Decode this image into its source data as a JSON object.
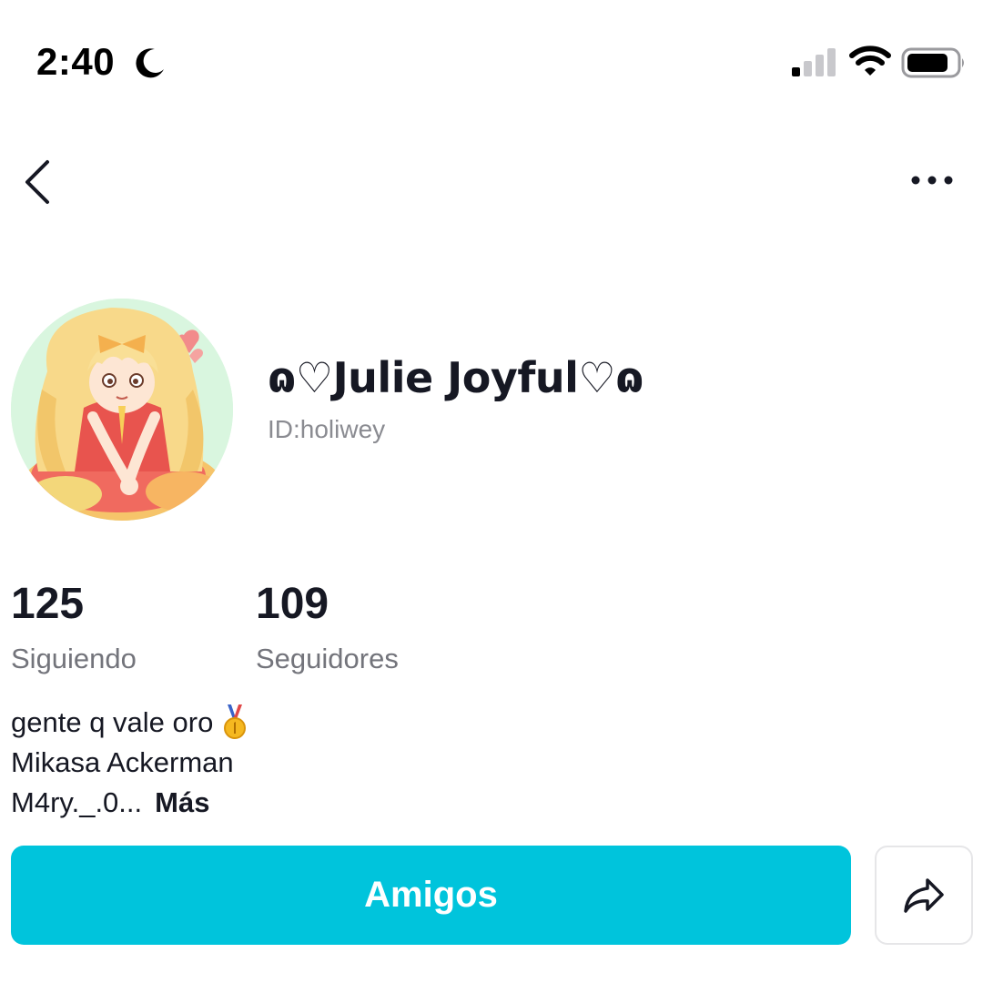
{
  "status_bar": {
    "time": "2:40",
    "icons": [
      "moon-icon",
      "cellular-signal-icon",
      "wifi-icon",
      "battery-icon"
    ]
  },
  "nav": {
    "back_icon": "chevron-left-icon",
    "more_icon": "ellipsis-icon"
  },
  "profile": {
    "avatar": "avatar-illustration",
    "display_name": "ɷ♡Julie Joyful♡ɷ",
    "user_id": "ID:holiwey"
  },
  "stats": {
    "following": {
      "count": "125",
      "label": "Siguiendo"
    },
    "followers": {
      "count": "109",
      "label": "Seguidores"
    }
  },
  "bio": {
    "lines": [
      "gente q vale oro",
      "Mikasa Ackerman",
      "M4ry._.0..."
    ],
    "emoji": "medal-icon",
    "more_label": "Más"
  },
  "actions": {
    "friends_label": "Amigos",
    "share_icon": "share-arrow-icon"
  },
  "colors": {
    "accent": "#00c4dc",
    "text_primary": "#161823",
    "text_secondary": "#8a8b91"
  }
}
